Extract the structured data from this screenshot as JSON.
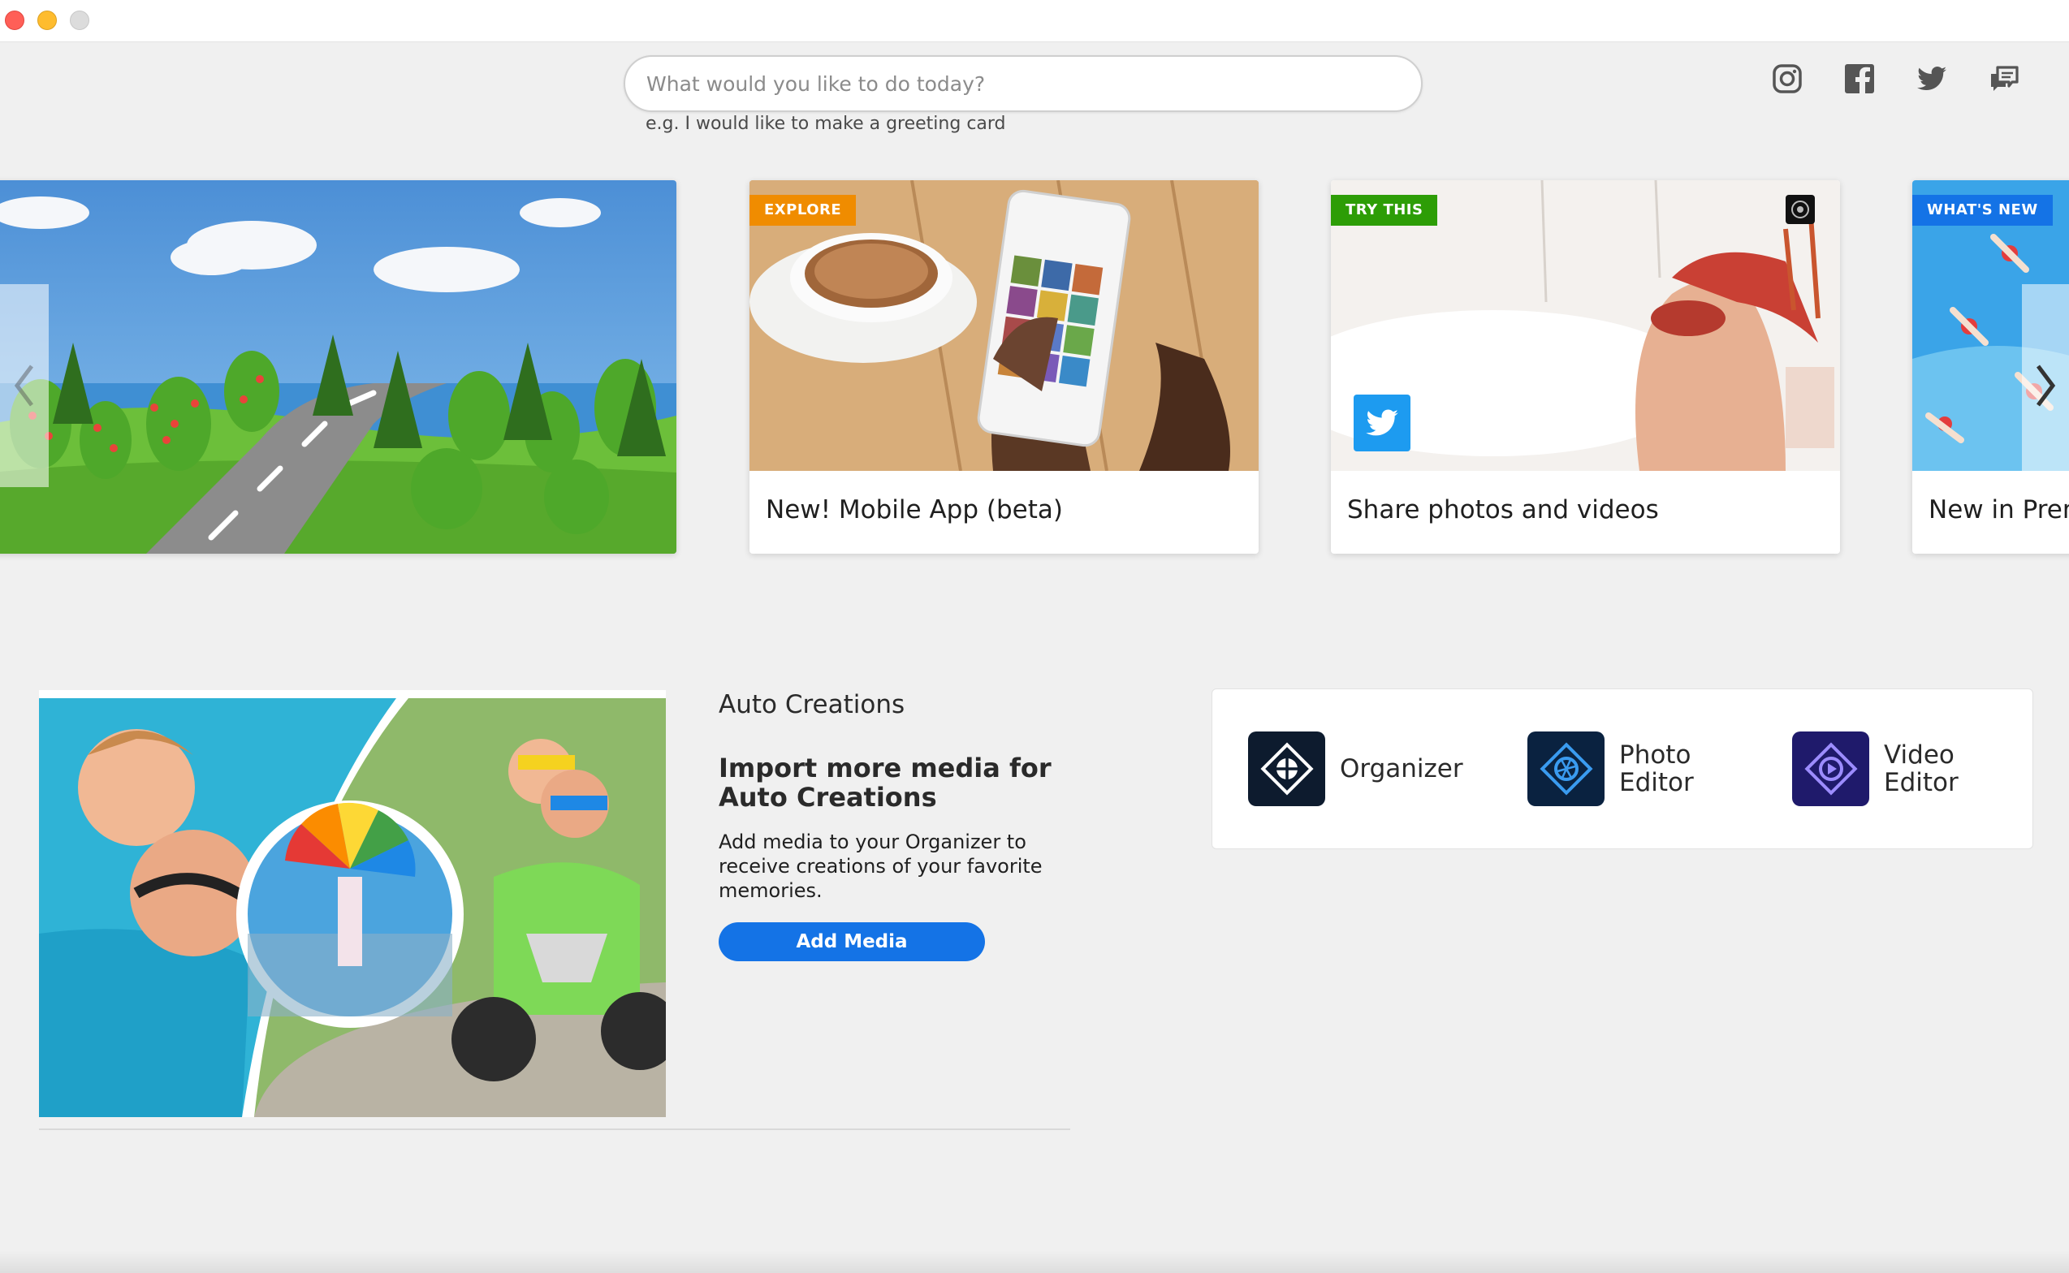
{
  "search": {
    "placeholder": "What would you like to do today?",
    "hint": "e.g. I would like to make a greeting card"
  },
  "social": [
    "instagram-icon",
    "facebook-icon",
    "twitter-icon",
    "feedback-icon"
  ],
  "carousel": {
    "cards": [
      {
        "badge": "",
        "caption": ""
      },
      {
        "badge": "EXPLORE",
        "badge_color": "#f08c00",
        "caption": "New! Mobile App (beta)"
      },
      {
        "badge": "TRY THIS",
        "badge_color": "#2d9d06",
        "caption": "Share photos and videos"
      },
      {
        "badge": "WHAT'S NEW",
        "badge_color": "#1473e6",
        "caption": "New in Prem"
      }
    ]
  },
  "auto_creations": {
    "title": "Auto Creations",
    "heading": "Import more media for Auto Creations",
    "body": "Add media to your Organizer to receive creations of your favorite memories.",
    "button": "Add Media"
  },
  "apps": [
    {
      "label": "Organizer",
      "icon": "organizer-icon"
    },
    {
      "label": "Photo Editor",
      "icon": "photo-editor-icon"
    },
    {
      "label": "Video Editor",
      "icon": "video-editor-icon"
    }
  ],
  "colors": {
    "accent": "#1473e6",
    "explore": "#f08c00",
    "try_this": "#2d9d06",
    "background": "#f0f0f0"
  }
}
